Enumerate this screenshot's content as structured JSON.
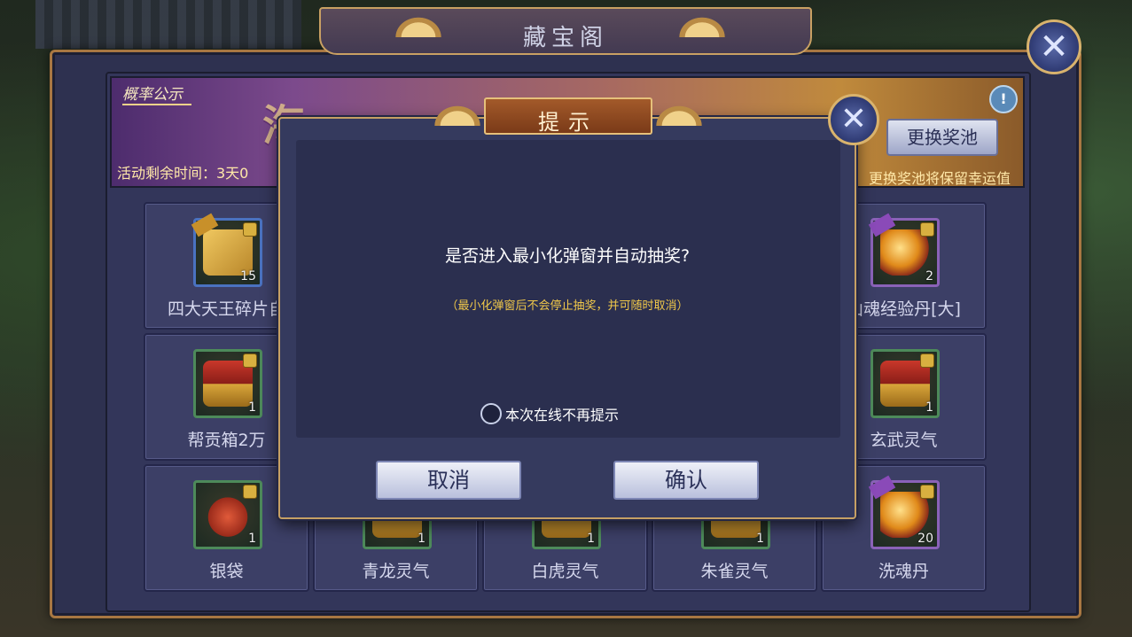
{
  "window": {
    "title": "藏宝阁"
  },
  "banner": {
    "tag": "概率公示",
    "headline": "海",
    "remaining_time": "活动剩余时间：3天0",
    "change_pool_button": "更换奖池",
    "hint": "更换奖池将保留幸运值",
    "info_badge": "!"
  },
  "items": [
    {
      "name": "四大天王碎片自",
      "qty": "15",
      "art": "puzzle",
      "frame": "blue",
      "tag": ""
    },
    {
      "name": "山魂经验丹[大]",
      "qty": "2",
      "art": "orb",
      "frame": "purple",
      "tag": ""
    },
    {
      "name": "帮贡箱2万",
      "qty": "1",
      "art": "chest",
      "frame": "green",
      "tag": ""
    },
    {
      "name": "玄武灵气",
      "qty": "1",
      "art": "chest",
      "frame": "green",
      "tag": ""
    },
    {
      "name": "银袋",
      "qty": "1",
      "art": "bag",
      "frame": "green",
      "tag": ""
    },
    {
      "name": "青龙灵气",
      "qty": "1",
      "art": "chest",
      "frame": "green",
      "tag": ""
    },
    {
      "name": "白虎灵气",
      "qty": "1",
      "art": "chest",
      "frame": "green",
      "tag": ""
    },
    {
      "name": "朱雀灵气",
      "qty": "1",
      "art": "chest",
      "frame": "green",
      "tag": ""
    },
    {
      "name": "洗魂丹",
      "qty": "20",
      "art": "orb",
      "frame": "purple",
      "tag": ""
    }
  ],
  "dialog": {
    "title": "提示",
    "question": "是否进入最小化弹窗并自动抽奖?",
    "note": "（最小化弹窗后不会停止抽奖，并可随时取消）",
    "checkbox_label": "本次在线不再提示",
    "checkbox_checked": false,
    "cancel_label": "取消",
    "confirm_label": "确认"
  },
  "close_glyph": "✕"
}
